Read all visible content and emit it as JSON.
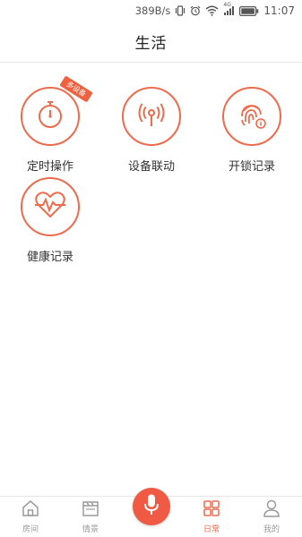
{
  "status_bar": {
    "speed": "389B/s",
    "network": "4G",
    "time": "11:07",
    "icons": [
      "vibrate-icon",
      "alarm-icon",
      "wifi-icon",
      "signal-icon",
      "battery-icon"
    ]
  },
  "header": {
    "title": "生活"
  },
  "features": [
    {
      "id": "timer",
      "label": "定时操作",
      "icon": "stopwatch-icon",
      "badge": "多设备"
    },
    {
      "id": "linkage",
      "label": "设备联动",
      "icon": "linkage-antenna-icon"
    },
    {
      "id": "unlock",
      "label": "开锁记录",
      "icon": "fingerprint-icon"
    },
    {
      "id": "health",
      "label": "健康记录",
      "icon": "heartbeat-icon"
    }
  ],
  "nav": {
    "items": [
      {
        "label": "房间",
        "icon": "house-icon"
      },
      {
        "label": "情景",
        "icon": "clapperboard-icon"
      },
      {
        "label": "日常",
        "icon": "grid-icon",
        "active": true
      },
      {
        "label": "我的",
        "icon": "person-icon"
      }
    ],
    "mic_icon": "microphone-icon"
  },
  "colors": {
    "accent": "#ee6c4d",
    "mic": "#f05a44",
    "nav_inactive": "#9a9a9a"
  }
}
